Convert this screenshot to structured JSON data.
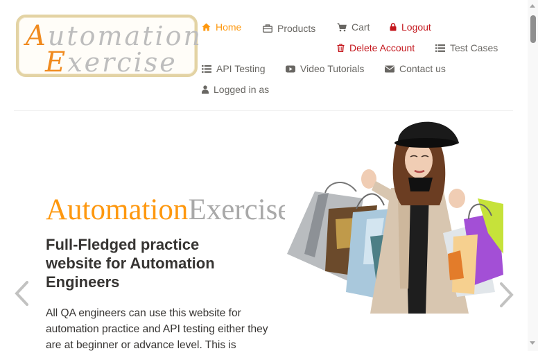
{
  "logo": {
    "line1_cap": "A",
    "line1_rest": "utomation",
    "line2_cap": "E",
    "line2_rest": "xercise"
  },
  "nav": {
    "home": {
      "label": "Home",
      "icon": "home-icon"
    },
    "products": {
      "label": "Products",
      "icon": "briefcase-icon"
    },
    "cart": {
      "label": "Cart",
      "icon": "cart-icon"
    },
    "logout": {
      "label": "Logout",
      "icon": "lock-icon"
    },
    "delete_account": {
      "label": "Delete Account",
      "icon": "trash-icon"
    },
    "test_cases": {
      "label": "Test Cases",
      "icon": "list-icon"
    },
    "api_testing": {
      "label": "API Testing",
      "icon": "list-icon"
    },
    "video_tutorials": {
      "label": "Video Tutorials",
      "icon": "youtube-icon"
    },
    "contact_us": {
      "label": "Contact us",
      "icon": "envelope-icon"
    },
    "logged_in": {
      "label": "Logged in as",
      "icon": "user-icon"
    }
  },
  "slider": {
    "brand_part1": "Automation",
    "brand_part2": "Exercise",
    "headline": "Full-Fledged practice website for Automation Engineers",
    "description": "All QA engineers can use this website for automation practice and API testing either they are at beginner or advance level. This is",
    "hero_image": "girl-with-shopping-bags-image"
  },
  "colors": {
    "accent": "#fe980f",
    "danger": "#c4161c",
    "text": "#696763",
    "heading": "#363432",
    "logo_border": "#e3d3a4"
  }
}
